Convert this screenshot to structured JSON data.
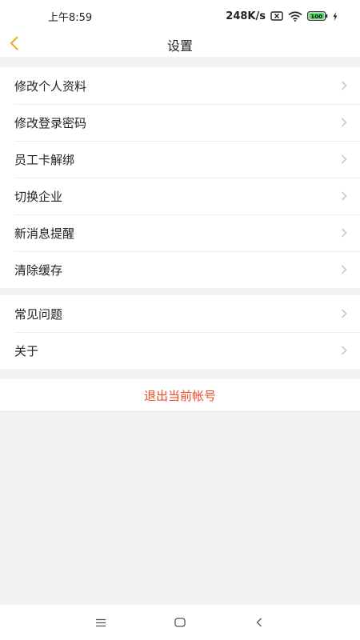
{
  "status_bar": {
    "time": "上午8:59",
    "network_speed": "248K/s",
    "battery_level": "100",
    "icons": [
      "sim-x-icon",
      "wifi-icon",
      "battery-icon",
      "charging-icon"
    ]
  },
  "header": {
    "back_icon": "chevron-left-icon",
    "title": "设置"
  },
  "section1": {
    "items": [
      {
        "label": "修改个人资料"
      },
      {
        "label": "修改登录密码"
      },
      {
        "label": "员工卡解绑"
      },
      {
        "label": "切换企业"
      },
      {
        "label": "新消息提醒"
      },
      {
        "label": "清除缓存"
      }
    ]
  },
  "section2": {
    "items": [
      {
        "label": "常见问题"
      },
      {
        "label": "关于"
      }
    ]
  },
  "logout": {
    "label": "退出当前帐号"
  },
  "colors": {
    "accent": "#f5a623",
    "danger": "#f04a24",
    "background": "#f2f2f2"
  },
  "system_nav": {
    "icons": [
      "menu-icon",
      "home-icon",
      "back-icon"
    ]
  }
}
